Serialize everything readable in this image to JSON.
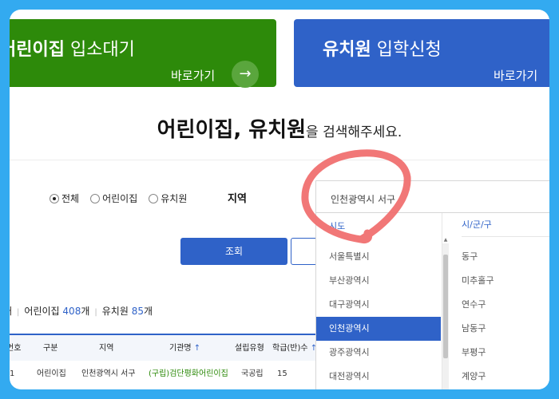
{
  "banners": {
    "daycare": {
      "title_bold": "어린이집",
      "title_rest": " 입소대기",
      "link": "바로가기"
    },
    "kindergarten": {
      "title_bold": "유치원",
      "title_rest": " 입학신청",
      "link": "바로가기"
    }
  },
  "heading": {
    "bold": "어린이집, 유치원",
    "suffix": "을 검색해주세요."
  },
  "filters": {
    "options": [
      "전체",
      "어린이집",
      "유치원"
    ],
    "selected": "전체",
    "region_label": "지역",
    "region_value": "인천광역시 서구"
  },
  "buttons": {
    "search": "조회"
  },
  "counts": {
    "lead": "개",
    "daycare_label": "어린이집",
    "daycare_count": "408",
    "unit": "개",
    "kindergarten_label": "유치원",
    "kindergarten_count": "85"
  },
  "table": {
    "headers": [
      "번호",
      "구분",
      "지역",
      "기관명",
      "설립유형",
      "학급(반)수"
    ],
    "rows": [
      [
        "1",
        "어린이집",
        "인천광역시 서구",
        "(구립)검단평화어린이집",
        "국공립",
        "15"
      ]
    ]
  },
  "dropdown": {
    "city_header": "시도",
    "cities": [
      "서울특별시",
      "부산광역시",
      "대구광역시",
      "인천광역시",
      "광주광역시",
      "대전광역시"
    ],
    "selected_city": "인천광역시",
    "district_header": "시/군/구",
    "districts": [
      "동구",
      "미추홀구",
      "연수구",
      "남동구",
      "부평구",
      "계양구"
    ]
  },
  "colors": {
    "frame": "#33aaf0",
    "green": "#2d8a0a",
    "blue": "#2f62c8",
    "annotation": "#f07070"
  }
}
